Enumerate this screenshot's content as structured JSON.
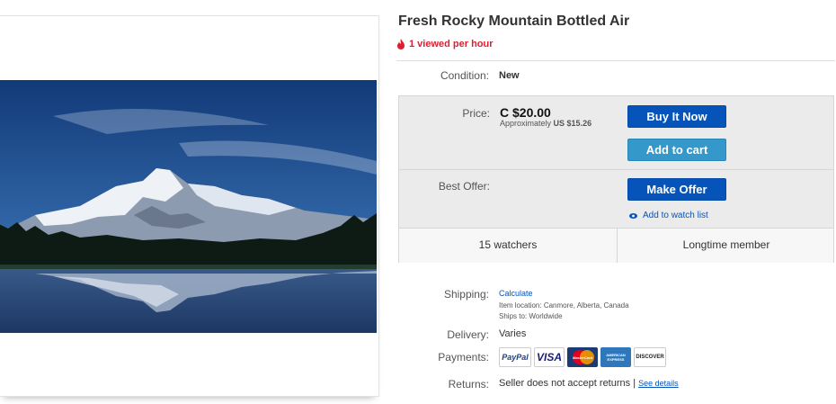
{
  "item": {
    "title": "Fresh Rocky Mountain Bottled Air",
    "views_text": "1 viewed per hour"
  },
  "condition": {
    "label": "Condition:",
    "value": "New"
  },
  "price": {
    "label": "Price:",
    "value": "C $20.00",
    "approx_prefix": "Approximately",
    "approx_value": "US $15.26"
  },
  "buttons": {
    "buy_now": "Buy It Now",
    "add_to_cart": "Add to cart",
    "make_offer": "Make Offer",
    "watch": "Add to watch list"
  },
  "best_offer": {
    "label": "Best Offer:"
  },
  "stats": {
    "watchers": "15 watchers",
    "member": "Longtime member"
  },
  "shipping": {
    "label": "Shipping:",
    "value": "Calculate",
    "location_label": "Item location:",
    "location": "Canmore, Alberta, Canada",
    "ships_label": "Ships to:",
    "ships_to": "Worldwide"
  },
  "delivery": {
    "label": "Delivery:",
    "value": "Varies"
  },
  "payments": {
    "label": "Payments:",
    "methods": [
      "PayPal",
      "VISA",
      "MasterCard",
      "AMERICAN EXPRESS",
      "DISCOVER"
    ]
  },
  "returns": {
    "label": "Returns:",
    "value": "Seller does not accept returns",
    "separator": "|",
    "link": "See details"
  },
  "colors": {
    "ebay_blue": "#0654ba",
    "cart_blue": "#3498ca",
    "alert_red": "#dd1e31"
  }
}
